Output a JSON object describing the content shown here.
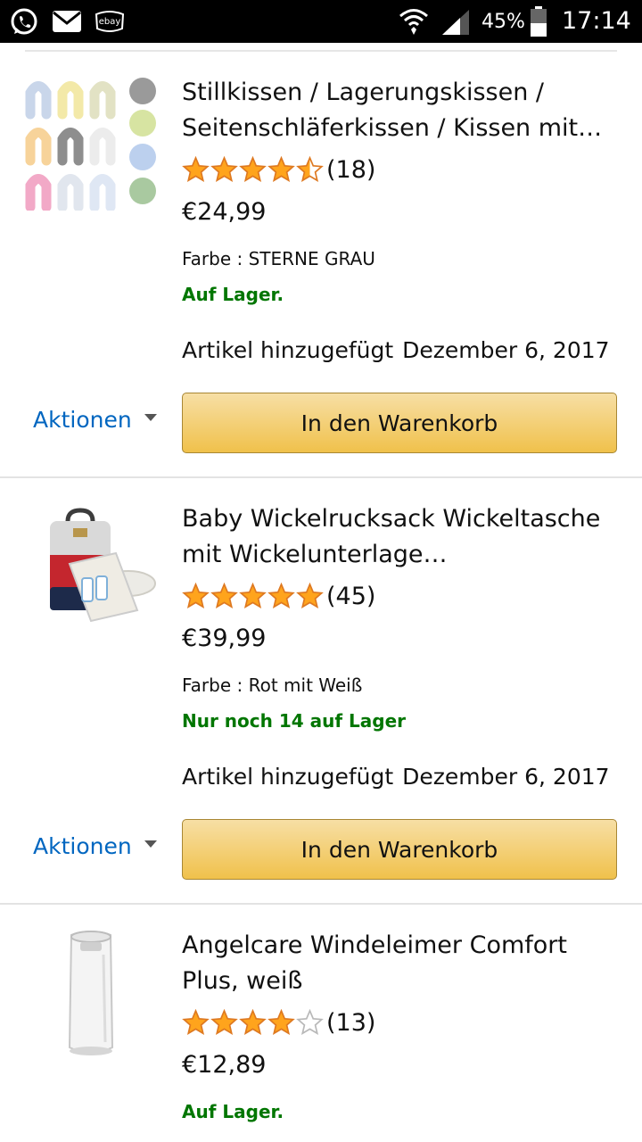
{
  "status_bar": {
    "battery": "45%",
    "time": "17:14",
    "icons": [
      "whatsapp-icon",
      "mail-icon",
      "ebay-kleinanzeigen-icon",
      "wifi-icon",
      "signal-icon",
      "battery-icon"
    ],
    "ebay_logo_text": "ebay"
  },
  "colors": {
    "link": "#0066c0",
    "in_stock": "#007600",
    "button": "#f0c14b",
    "star": "#ffa41c"
  },
  "items": [
    {
      "title": "Stillkissen / Lagerungskissen / Seitenschläferkissen / Kissen mit…",
      "rating": 4.5,
      "review_count": "(18)",
      "price": "€24,99",
      "color": "Farbe : STERNE GRAU",
      "stock": "Auf Lager.",
      "added_label": "Artikel hinzugefügt",
      "added_date": "Dezember 6, 2017",
      "actions_label": "Aktionen",
      "cart_label": "In den Warenkorb"
    },
    {
      "title": "Baby Wickelrucksack Wickeltasche mit Wickelunterlage…",
      "rating": 5,
      "review_count": "(45)",
      "price": "€39,99",
      "color": "Farbe : Rot mit Weiß",
      "stock": "Nur noch 14 auf Lager",
      "added_label": "Artikel hinzugefügt",
      "added_date": "Dezember 6, 2017",
      "actions_label": "Aktionen",
      "cart_label": "In den Warenkorb"
    },
    {
      "title": "Angelcare Windeleimer Comfort Plus, weiß",
      "rating": 4,
      "review_count": "(13)",
      "price": "€12,89",
      "stock": "Auf Lager."
    }
  ]
}
